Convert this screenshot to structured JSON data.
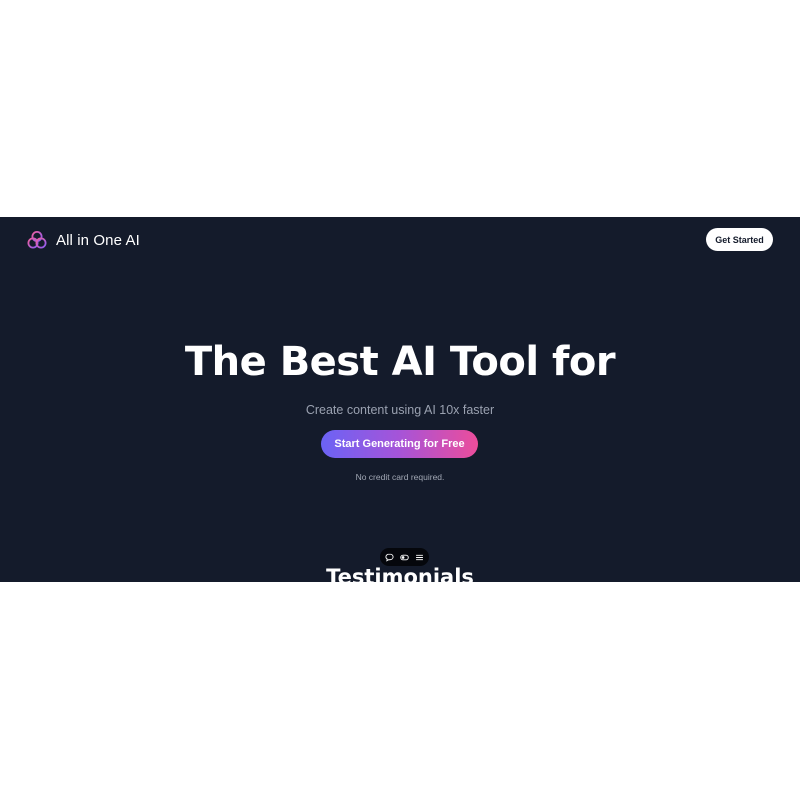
{
  "header": {
    "brand_name": "All in One AI",
    "logo_icon": "interlocking-rings-icon",
    "cta_label": "Get Started"
  },
  "hero": {
    "title": "The Best AI Tool for",
    "subtitle": "Create content using AI 10x faster",
    "cta_label": "Start Generating for Free",
    "note": "No credit card required."
  },
  "toolbar": {
    "icons": [
      "chat-bubble-icon",
      "toggle-icon",
      "menu-icon"
    ]
  },
  "testimonials": {
    "title": "Testimonials"
  },
  "colors": {
    "page_background": "#ffffff",
    "hero_background": "#141b2b",
    "gradient_start": "#6b63f5",
    "gradient_mid": "#a654d8",
    "gradient_end": "#ec4d9b",
    "cta_top_background": "#ffffff"
  }
}
